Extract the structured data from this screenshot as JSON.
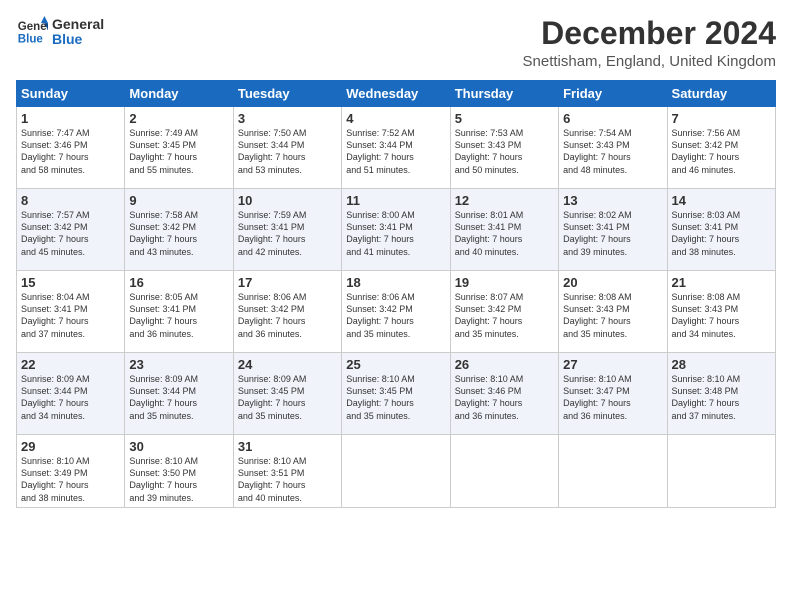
{
  "logo": {
    "line1": "General",
    "line2": "Blue"
  },
  "title": "December 2024",
  "location": "Snettisham, England, United Kingdom",
  "headers": [
    "Sunday",
    "Monday",
    "Tuesday",
    "Wednesday",
    "Thursday",
    "Friday",
    "Saturday"
  ],
  "weeks": [
    [
      {
        "day": 1,
        "rise": "7:47 AM",
        "set": "3:46 PM",
        "daylight": "7 hours and 58 minutes."
      },
      {
        "day": 2,
        "rise": "7:49 AM",
        "set": "3:45 PM",
        "daylight": "7 hours and 55 minutes."
      },
      {
        "day": 3,
        "rise": "7:50 AM",
        "set": "3:44 PM",
        "daylight": "7 hours and 53 minutes."
      },
      {
        "day": 4,
        "rise": "7:52 AM",
        "set": "3:44 PM",
        "daylight": "7 hours and 51 minutes."
      },
      {
        "day": 5,
        "rise": "7:53 AM",
        "set": "3:43 PM",
        "daylight": "7 hours and 50 minutes."
      },
      {
        "day": 6,
        "rise": "7:54 AM",
        "set": "3:43 PM",
        "daylight": "7 hours and 48 minutes."
      },
      {
        "day": 7,
        "rise": "7:56 AM",
        "set": "3:42 PM",
        "daylight": "7 hours and 46 minutes."
      }
    ],
    [
      {
        "day": 8,
        "rise": "7:57 AM",
        "set": "3:42 PM",
        "daylight": "7 hours and 45 minutes."
      },
      {
        "day": 9,
        "rise": "7:58 AM",
        "set": "3:42 PM",
        "daylight": "7 hours and 43 minutes."
      },
      {
        "day": 10,
        "rise": "7:59 AM",
        "set": "3:41 PM",
        "daylight": "7 hours and 42 minutes."
      },
      {
        "day": 11,
        "rise": "8:00 AM",
        "set": "3:41 PM",
        "daylight": "7 hours and 41 minutes."
      },
      {
        "day": 12,
        "rise": "8:01 AM",
        "set": "3:41 PM",
        "daylight": "7 hours and 40 minutes."
      },
      {
        "day": 13,
        "rise": "8:02 AM",
        "set": "3:41 PM",
        "daylight": "7 hours and 39 minutes."
      },
      {
        "day": 14,
        "rise": "8:03 AM",
        "set": "3:41 PM",
        "daylight": "7 hours and 38 minutes."
      }
    ],
    [
      {
        "day": 15,
        "rise": "8:04 AM",
        "set": "3:41 PM",
        "daylight": "7 hours and 37 minutes."
      },
      {
        "day": 16,
        "rise": "8:05 AM",
        "set": "3:41 PM",
        "daylight": "7 hours and 36 minutes."
      },
      {
        "day": 17,
        "rise": "8:06 AM",
        "set": "3:42 PM",
        "daylight": "7 hours and 36 minutes."
      },
      {
        "day": 18,
        "rise": "8:06 AM",
        "set": "3:42 PM",
        "daylight": "7 hours and 35 minutes."
      },
      {
        "day": 19,
        "rise": "8:07 AM",
        "set": "3:42 PM",
        "daylight": "7 hours and 35 minutes."
      },
      {
        "day": 20,
        "rise": "8:08 AM",
        "set": "3:43 PM",
        "daylight": "7 hours and 35 minutes."
      },
      {
        "day": 21,
        "rise": "8:08 AM",
        "set": "3:43 PM",
        "daylight": "7 hours and 34 minutes."
      }
    ],
    [
      {
        "day": 22,
        "rise": "8:09 AM",
        "set": "3:44 PM",
        "daylight": "7 hours and 34 minutes."
      },
      {
        "day": 23,
        "rise": "8:09 AM",
        "set": "3:44 PM",
        "daylight": "7 hours and 35 minutes."
      },
      {
        "day": 24,
        "rise": "8:09 AM",
        "set": "3:45 PM",
        "daylight": "7 hours and 35 minutes."
      },
      {
        "day": 25,
        "rise": "8:10 AM",
        "set": "3:45 PM",
        "daylight": "7 hours and 35 minutes."
      },
      {
        "day": 26,
        "rise": "8:10 AM",
        "set": "3:46 PM",
        "daylight": "7 hours and 36 minutes."
      },
      {
        "day": 27,
        "rise": "8:10 AM",
        "set": "3:47 PM",
        "daylight": "7 hours and 36 minutes."
      },
      {
        "day": 28,
        "rise": "8:10 AM",
        "set": "3:48 PM",
        "daylight": "7 hours and 37 minutes."
      }
    ],
    [
      {
        "day": 29,
        "rise": "8:10 AM",
        "set": "3:49 PM",
        "daylight": "7 hours and 38 minutes."
      },
      {
        "day": 30,
        "rise": "8:10 AM",
        "set": "3:50 PM",
        "daylight": "7 hours and 39 minutes."
      },
      {
        "day": 31,
        "rise": "8:10 AM",
        "set": "3:51 PM",
        "daylight": "7 hours and 40 minutes."
      },
      null,
      null,
      null,
      null
    ]
  ]
}
